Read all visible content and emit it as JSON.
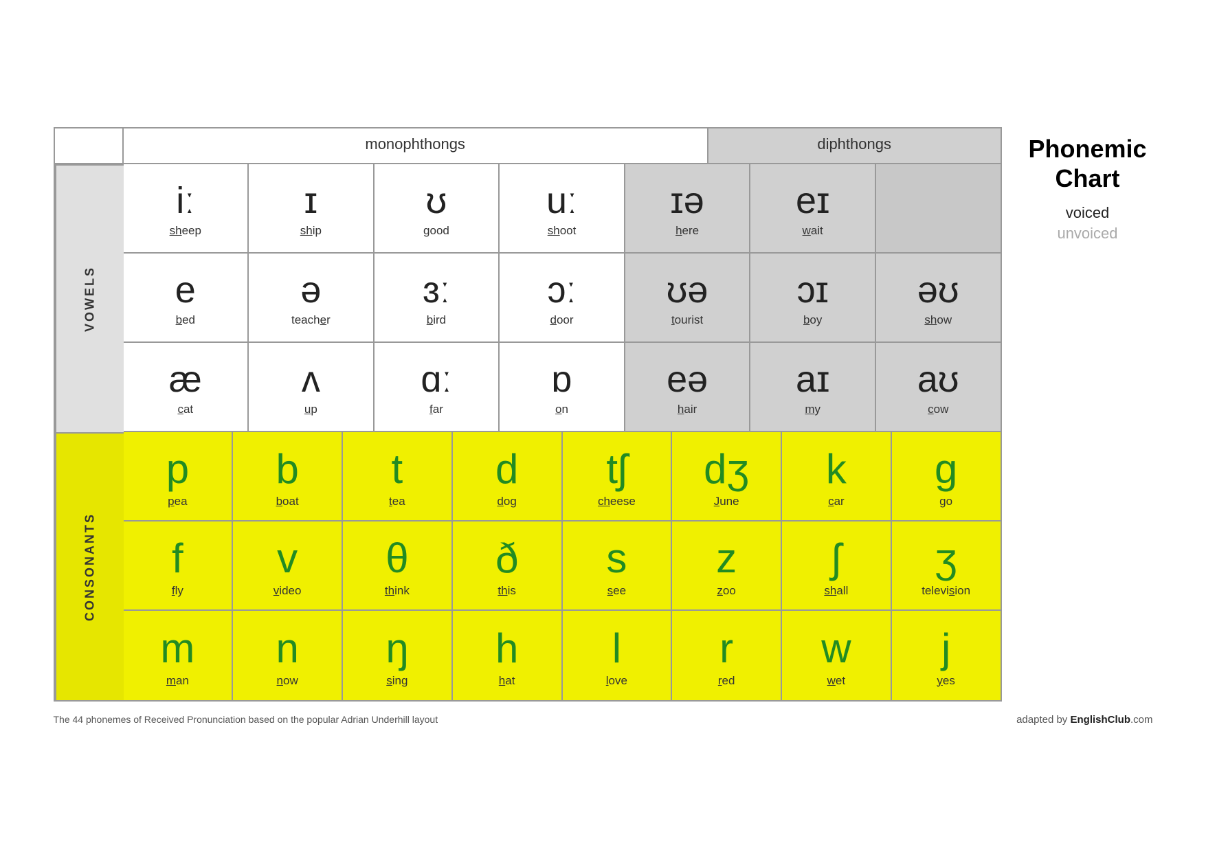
{
  "title": "Phonemic\nChart",
  "legend": {
    "voiced": "voiced",
    "unvoiced": "unvoiced"
  },
  "header": {
    "monophthongs": "monophthongs",
    "diphthongs": "diphthongs"
  },
  "labels": {
    "vowels": "VOWELS",
    "consonants": "CONSONANTS"
  },
  "vowel_rows": [
    {
      "cells": [
        {
          "symbol": "iː",
          "word": "sheep",
          "underline": "sh",
          "type": "mono"
        },
        {
          "symbol": "ɪ",
          "word": "ship",
          "underline": "sh",
          "type": "mono"
        },
        {
          "symbol": "ʊ",
          "word": "good",
          "underline": "g",
          "type": "mono"
        },
        {
          "symbol": "uː",
          "word": "shoot",
          "underline": "sh",
          "type": "mono"
        },
        {
          "symbol": "ɪə",
          "word": "here",
          "underline": "h",
          "type": "di"
        },
        {
          "symbol": "eɪ",
          "word": "wait",
          "underline": "w",
          "type": "di"
        }
      ]
    },
    {
      "cells": [
        {
          "symbol": "e",
          "word": "bed",
          "underline": "b",
          "type": "mono"
        },
        {
          "symbol": "ə",
          "word": "teacher",
          "underline": "teach",
          "type": "mono"
        },
        {
          "symbol": "ɜː",
          "word": "bird",
          "underline": "b",
          "type": "mono"
        },
        {
          "symbol": "ɔː",
          "word": "door",
          "underline": "d",
          "type": "mono"
        },
        {
          "symbol": "ʊə",
          "word": "tourist",
          "underline": "t",
          "type": "di"
        },
        {
          "symbol": "ɔɪ",
          "word": "boy",
          "underline": "b",
          "type": "di"
        },
        {
          "symbol": "əʊ",
          "word": "show",
          "underline": "sh",
          "type": "di"
        }
      ]
    },
    {
      "cells": [
        {
          "symbol": "æ",
          "word": "cat",
          "underline": "c",
          "type": "mono"
        },
        {
          "symbol": "ʌ",
          "word": "up",
          "underline": "u",
          "type": "mono"
        },
        {
          "symbol": "ɑː",
          "word": "far",
          "underline": "f",
          "type": "mono"
        },
        {
          "symbol": "ɒ",
          "word": "on",
          "underline": "o",
          "type": "mono"
        },
        {
          "symbol": "eə",
          "word": "hair",
          "underline": "h",
          "type": "di"
        },
        {
          "symbol": "aɪ",
          "word": "my",
          "underline": "m",
          "type": "di"
        },
        {
          "symbol": "aʊ",
          "word": "cow",
          "underline": "c",
          "type": "di"
        }
      ]
    }
  ],
  "consonant_rows": [
    {
      "cells": [
        {
          "symbol": "p",
          "word": "pea",
          "underline": "p",
          "type": "con"
        },
        {
          "symbol": "b",
          "word": "boat",
          "underline": "b",
          "type": "con"
        },
        {
          "symbol": "t",
          "word": "tea",
          "underline": "t",
          "type": "con"
        },
        {
          "symbol": "d",
          "word": "dog",
          "underline": "d",
          "type": "con"
        },
        {
          "symbol": "tʃ",
          "word": "cheese",
          "underline": "ch",
          "type": "con"
        },
        {
          "symbol": "dʒ",
          "word": "June",
          "underline": "J",
          "type": "con"
        },
        {
          "symbol": "k",
          "word": "car",
          "underline": "c",
          "type": "con"
        },
        {
          "symbol": "g",
          "word": "go",
          "underline": "g",
          "type": "con"
        }
      ]
    },
    {
      "cells": [
        {
          "symbol": "f",
          "word": "fly",
          "underline": "f",
          "type": "con"
        },
        {
          "symbol": "v",
          "word": "video",
          "underline": "v",
          "type": "con"
        },
        {
          "symbol": "θ",
          "word": "think",
          "underline": "th",
          "type": "con"
        },
        {
          "symbol": "ð",
          "word": "this",
          "underline": "th",
          "type": "con"
        },
        {
          "symbol": "s",
          "word": "see",
          "underline": "s",
          "type": "con"
        },
        {
          "symbol": "z",
          "word": "zoo",
          "underline": "z",
          "type": "con"
        },
        {
          "symbol": "ʃ",
          "word": "shall",
          "underline": "sh",
          "type": "con"
        },
        {
          "symbol": "ʒ",
          "word": "television",
          "underline": "televi",
          "type": "con"
        }
      ]
    },
    {
      "cells": [
        {
          "symbol": "m",
          "word": "man",
          "underline": "m",
          "type": "con"
        },
        {
          "symbol": "n",
          "word": "now",
          "underline": "n",
          "type": "con"
        },
        {
          "symbol": "ŋ",
          "word": "sing",
          "underline": "s",
          "type": "con"
        },
        {
          "symbol": "h",
          "word": "hat",
          "underline": "h",
          "type": "con"
        },
        {
          "symbol": "l",
          "word": "love",
          "underline": "l",
          "type": "con"
        },
        {
          "symbol": "r",
          "word": "red",
          "underline": "r",
          "type": "con"
        },
        {
          "symbol": "w",
          "word": "wet",
          "underline": "w",
          "type": "con"
        },
        {
          "symbol": "j",
          "word": "yes",
          "underline": "y",
          "type": "con"
        }
      ]
    }
  ],
  "footer": {
    "left": "The 44 phonemes of Received Pronunciation based on the popular Adrian Underhill layout",
    "right_prefix": "adapted by ",
    "right_brand": "EnglishClub",
    "right_suffix": ".com"
  }
}
